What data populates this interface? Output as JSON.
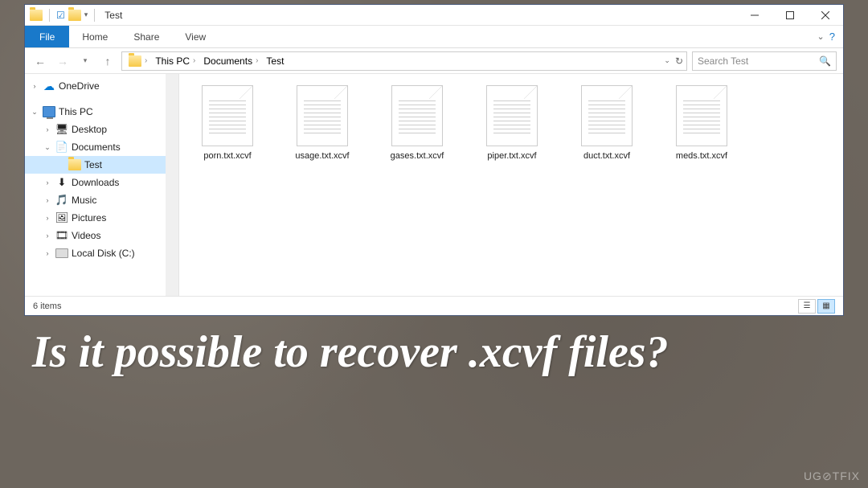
{
  "window": {
    "title": "Test"
  },
  "ribbon": {
    "file": "File",
    "tabs": [
      "Home",
      "Share",
      "View"
    ]
  },
  "breadcrumb": {
    "items": [
      "This PC",
      "Documents",
      "Test"
    ]
  },
  "search": {
    "placeholder": "Search Test"
  },
  "sidebar": {
    "onedrive": "OneDrive",
    "thispc": "This PC",
    "items": [
      {
        "label": "Desktop"
      },
      {
        "label": "Documents"
      },
      {
        "label": "Test",
        "selected": true
      },
      {
        "label": "Downloads"
      },
      {
        "label": "Music"
      },
      {
        "label": "Pictures"
      },
      {
        "label": "Videos"
      },
      {
        "label": "Local Disk (C:)"
      }
    ]
  },
  "files": [
    {
      "name": "porn.txt.xcvf"
    },
    {
      "name": "usage.txt.xcvf"
    },
    {
      "name": "gases.txt.xcvf"
    },
    {
      "name": "piper.txt.xcvf"
    },
    {
      "name": "duct.txt.xcvf"
    },
    {
      "name": "meds.txt.xcvf"
    }
  ],
  "status": {
    "count": "6 items"
  },
  "caption": "Is it possible to recover .xcvf files?",
  "watermark": "UG⊘TFIX"
}
